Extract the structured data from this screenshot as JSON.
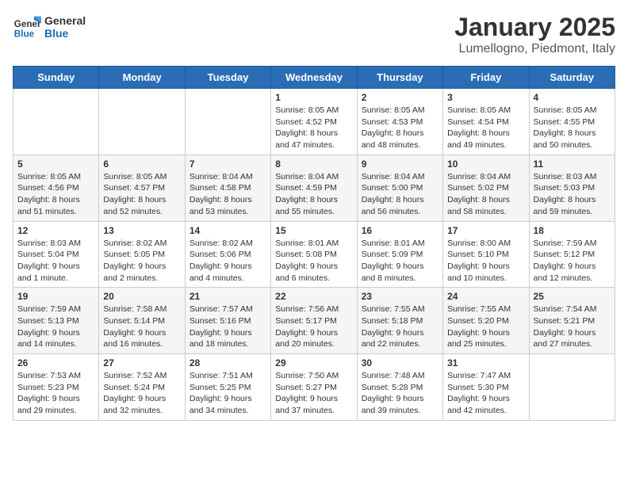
{
  "header": {
    "logo_line1": "General",
    "logo_line2": "Blue",
    "title": "January 2025",
    "subtitle": "Lumellogno, Piedmont, Italy"
  },
  "weekdays": [
    "Sunday",
    "Monday",
    "Tuesday",
    "Wednesday",
    "Thursday",
    "Friday",
    "Saturday"
  ],
  "weeks": [
    [
      {
        "day": "",
        "info": ""
      },
      {
        "day": "",
        "info": ""
      },
      {
        "day": "",
        "info": ""
      },
      {
        "day": "1",
        "info": "Sunrise: 8:05 AM\nSunset: 4:52 PM\nDaylight: 8 hours and 47 minutes."
      },
      {
        "day": "2",
        "info": "Sunrise: 8:05 AM\nSunset: 4:53 PM\nDaylight: 8 hours and 48 minutes."
      },
      {
        "day": "3",
        "info": "Sunrise: 8:05 AM\nSunset: 4:54 PM\nDaylight: 8 hours and 49 minutes."
      },
      {
        "day": "4",
        "info": "Sunrise: 8:05 AM\nSunset: 4:55 PM\nDaylight: 8 hours and 50 minutes."
      }
    ],
    [
      {
        "day": "5",
        "info": "Sunrise: 8:05 AM\nSunset: 4:56 PM\nDaylight: 8 hours and 51 minutes."
      },
      {
        "day": "6",
        "info": "Sunrise: 8:05 AM\nSunset: 4:57 PM\nDaylight: 8 hours and 52 minutes."
      },
      {
        "day": "7",
        "info": "Sunrise: 8:04 AM\nSunset: 4:58 PM\nDaylight: 8 hours and 53 minutes."
      },
      {
        "day": "8",
        "info": "Sunrise: 8:04 AM\nSunset: 4:59 PM\nDaylight: 8 hours and 55 minutes."
      },
      {
        "day": "9",
        "info": "Sunrise: 8:04 AM\nSunset: 5:00 PM\nDaylight: 8 hours and 56 minutes."
      },
      {
        "day": "10",
        "info": "Sunrise: 8:04 AM\nSunset: 5:02 PM\nDaylight: 8 hours and 58 minutes."
      },
      {
        "day": "11",
        "info": "Sunrise: 8:03 AM\nSunset: 5:03 PM\nDaylight: 8 hours and 59 minutes."
      }
    ],
    [
      {
        "day": "12",
        "info": "Sunrise: 8:03 AM\nSunset: 5:04 PM\nDaylight: 9 hours and 1 minute."
      },
      {
        "day": "13",
        "info": "Sunrise: 8:02 AM\nSunset: 5:05 PM\nDaylight: 9 hours and 2 minutes."
      },
      {
        "day": "14",
        "info": "Sunrise: 8:02 AM\nSunset: 5:06 PM\nDaylight: 9 hours and 4 minutes."
      },
      {
        "day": "15",
        "info": "Sunrise: 8:01 AM\nSunset: 5:08 PM\nDaylight: 9 hours and 6 minutes."
      },
      {
        "day": "16",
        "info": "Sunrise: 8:01 AM\nSunset: 5:09 PM\nDaylight: 9 hours and 8 minutes."
      },
      {
        "day": "17",
        "info": "Sunrise: 8:00 AM\nSunset: 5:10 PM\nDaylight: 9 hours and 10 minutes."
      },
      {
        "day": "18",
        "info": "Sunrise: 7:59 AM\nSunset: 5:12 PM\nDaylight: 9 hours and 12 minutes."
      }
    ],
    [
      {
        "day": "19",
        "info": "Sunrise: 7:59 AM\nSunset: 5:13 PM\nDaylight: 9 hours and 14 minutes."
      },
      {
        "day": "20",
        "info": "Sunrise: 7:58 AM\nSunset: 5:14 PM\nDaylight: 9 hours and 16 minutes."
      },
      {
        "day": "21",
        "info": "Sunrise: 7:57 AM\nSunset: 5:16 PM\nDaylight: 9 hours and 18 minutes."
      },
      {
        "day": "22",
        "info": "Sunrise: 7:56 AM\nSunset: 5:17 PM\nDaylight: 9 hours and 20 minutes."
      },
      {
        "day": "23",
        "info": "Sunrise: 7:55 AM\nSunset: 5:18 PM\nDaylight: 9 hours and 22 minutes."
      },
      {
        "day": "24",
        "info": "Sunrise: 7:55 AM\nSunset: 5:20 PM\nDaylight: 9 hours and 25 minutes."
      },
      {
        "day": "25",
        "info": "Sunrise: 7:54 AM\nSunset: 5:21 PM\nDaylight: 9 hours and 27 minutes."
      }
    ],
    [
      {
        "day": "26",
        "info": "Sunrise: 7:53 AM\nSunset: 5:23 PM\nDaylight: 9 hours and 29 minutes."
      },
      {
        "day": "27",
        "info": "Sunrise: 7:52 AM\nSunset: 5:24 PM\nDaylight: 9 hours and 32 minutes."
      },
      {
        "day": "28",
        "info": "Sunrise: 7:51 AM\nSunset: 5:25 PM\nDaylight: 9 hours and 34 minutes."
      },
      {
        "day": "29",
        "info": "Sunrise: 7:50 AM\nSunset: 5:27 PM\nDaylight: 9 hours and 37 minutes."
      },
      {
        "day": "30",
        "info": "Sunrise: 7:48 AM\nSunset: 5:28 PM\nDaylight: 9 hours and 39 minutes."
      },
      {
        "day": "31",
        "info": "Sunrise: 7:47 AM\nSunset: 5:30 PM\nDaylight: 9 hours and 42 minutes."
      },
      {
        "day": "",
        "info": ""
      }
    ]
  ]
}
